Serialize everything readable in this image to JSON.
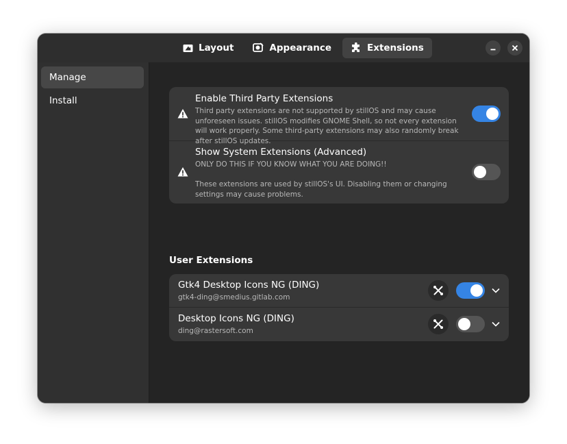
{
  "header": {
    "tabs": [
      {
        "label": "Layout",
        "icon": "layout-icon"
      },
      {
        "label": "Appearance",
        "icon": "appearance-icon"
      },
      {
        "label": "Extensions",
        "icon": "puzzle-icon"
      }
    ],
    "active_tab": "Extensions",
    "window_buttons": [
      "minimize",
      "close"
    ]
  },
  "sidebar": {
    "items": [
      {
        "label": "Manage"
      },
      {
        "label": "Install"
      }
    ],
    "selected": "Manage"
  },
  "settings": {
    "rows": [
      {
        "title": "Enable Third Party Extensions",
        "subtitle": "Third party extensions are not supported by stillOS and may cause unforeseen issues. stillOS modifies GNOME Shell, so not every extension will work properly. Some third-party extensions may also randomly break after stillOS updates.",
        "icon": "warning-icon",
        "enabled": true
      },
      {
        "title": "Show System Extensions (Advanced)",
        "subtitle_line1": "ONLY DO THIS IF YOU KNOW WHAT YOU ARE DOING!!",
        "subtitle_line2": "These extensions are used by stillOS's UI. Disabling them or changing settings may cause problems.",
        "icon": "warning-icon",
        "enabled": false
      }
    ]
  },
  "user_extensions": {
    "title": "User Extensions",
    "items": [
      {
        "name": "Gtk4 Desktop Icons NG (DING)",
        "uuid": "gtk4-ding@smedius.gitlab.com",
        "enabled": true
      },
      {
        "name": "Desktop Icons NG (DING)",
        "uuid": "ding@rastersoft.com",
        "enabled": false
      }
    ]
  },
  "colors": {
    "accent": "#3584e4",
    "window_bg": "#242424",
    "card_bg": "#383838",
    "sidebar_bg": "#303030"
  }
}
